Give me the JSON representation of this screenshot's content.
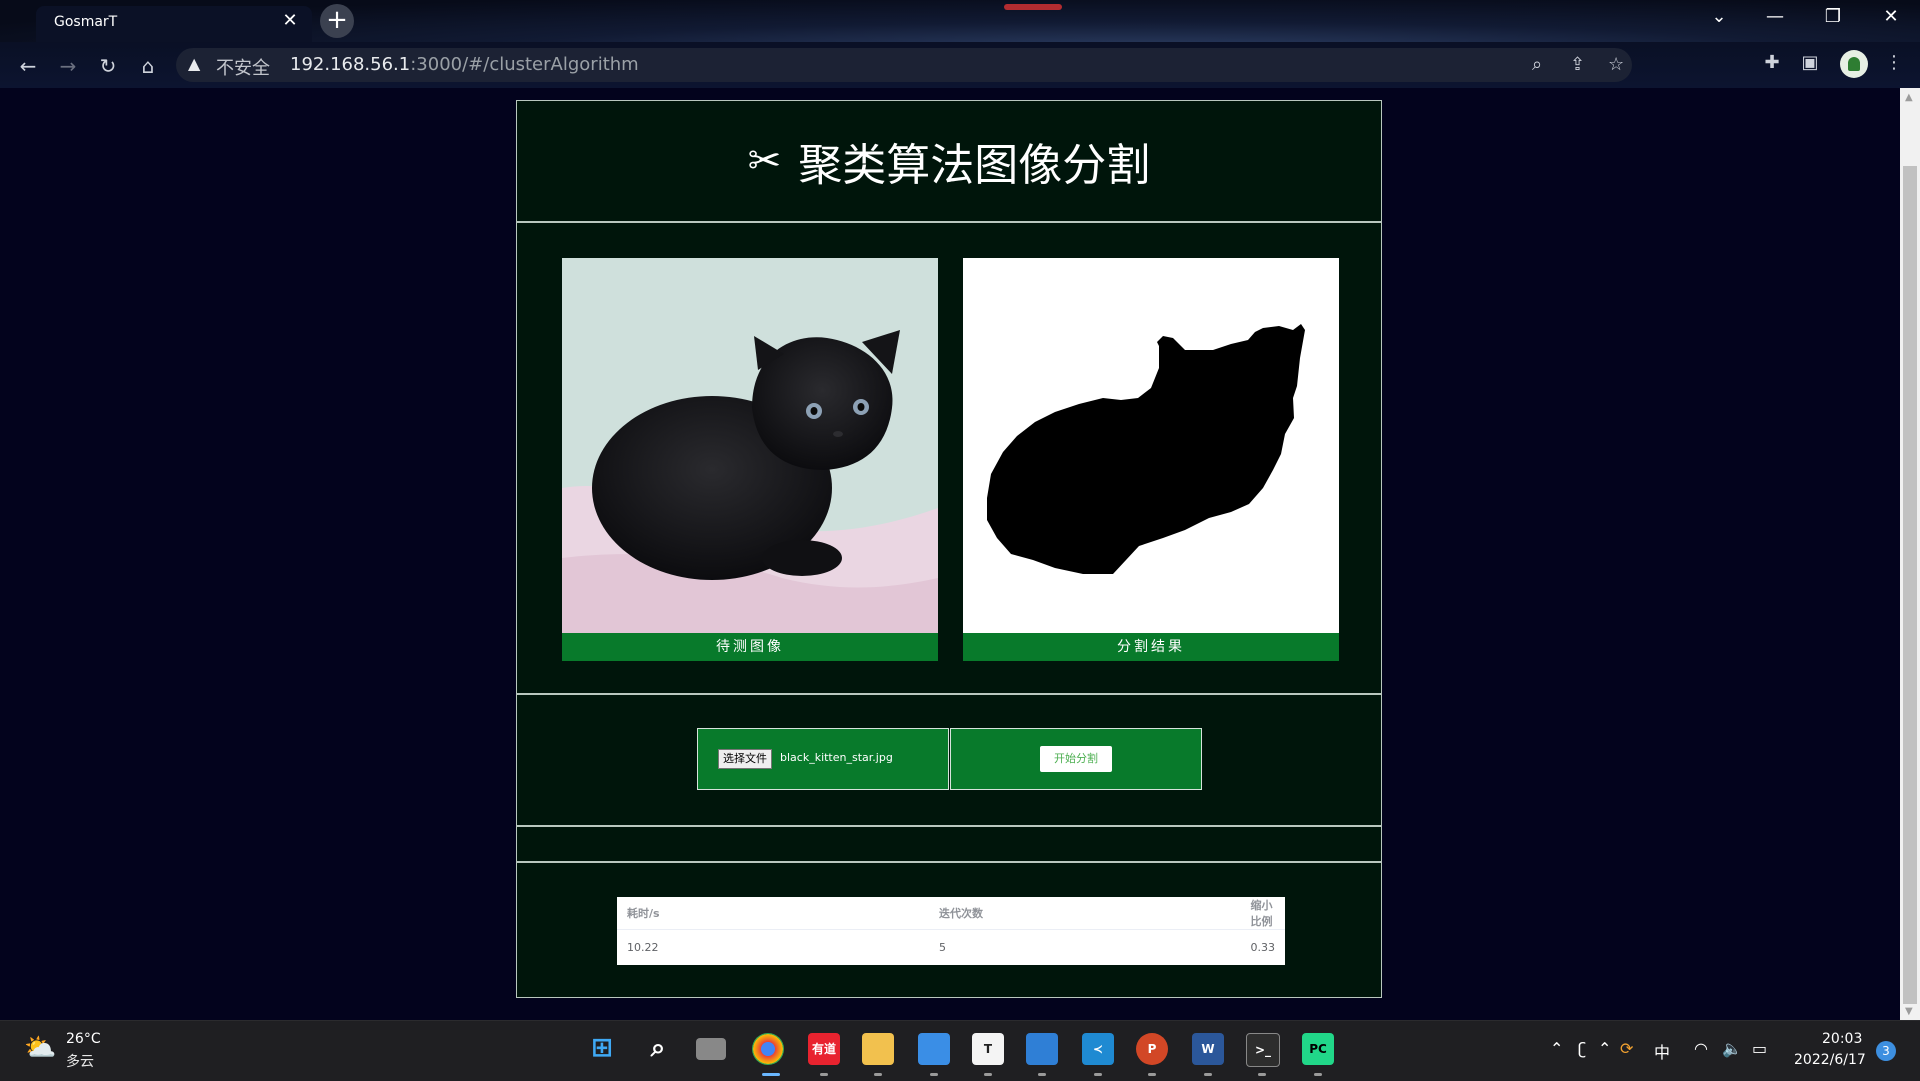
{
  "browser": {
    "tab_title": "GosmarT",
    "security_label": "不安全",
    "url_host": "192.168.56.1",
    "url_path": ":3000/#/clusterAlgorithm"
  },
  "page": {
    "title": "聚类算法图像分割",
    "input_caption": "待测图像",
    "result_caption": "分割结果",
    "file_button": "选择文件",
    "file_name": "black_kitten_star.jpg",
    "start_button": "开始分割",
    "stats": {
      "headers": [
        "耗时/s",
        "迭代次数",
        "缩小比例"
      ],
      "row": [
        "10.22",
        "5",
        "0.33"
      ]
    }
  },
  "taskbar": {
    "temperature": "26°C",
    "weather": "多云",
    "ime": "中",
    "time": "20:03",
    "date": "2022/6/17",
    "notifications": "3"
  },
  "colors": {
    "panel_bg": "#00150b",
    "accent_green": "#087a2b",
    "page_bg": "#03031d"
  }
}
